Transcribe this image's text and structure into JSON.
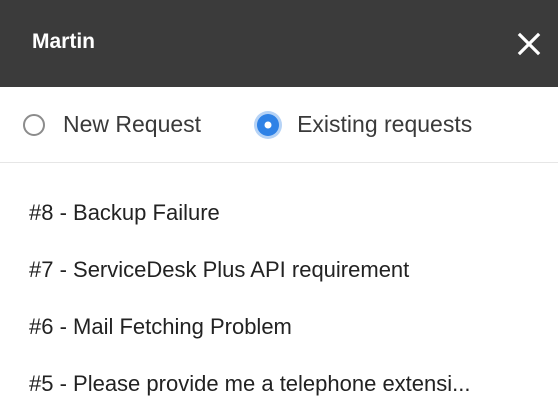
{
  "header": {
    "title": "Martin",
    "close_icon": "close-icon"
  },
  "radio_options": {
    "new_request": {
      "label": "New Request",
      "checked": false
    },
    "existing_requests": {
      "label": "Existing requests",
      "checked": true
    }
  },
  "requests": [
    "#8 - Backup Failure",
    "#7 - ServiceDesk Plus API requirement",
    "#6 - Mail Fetching Problem",
    "#5 - Please provide me a telephone extensi..."
  ],
  "colors": {
    "header_bg": "#3b3b3b",
    "accent": "#2f82e6"
  }
}
